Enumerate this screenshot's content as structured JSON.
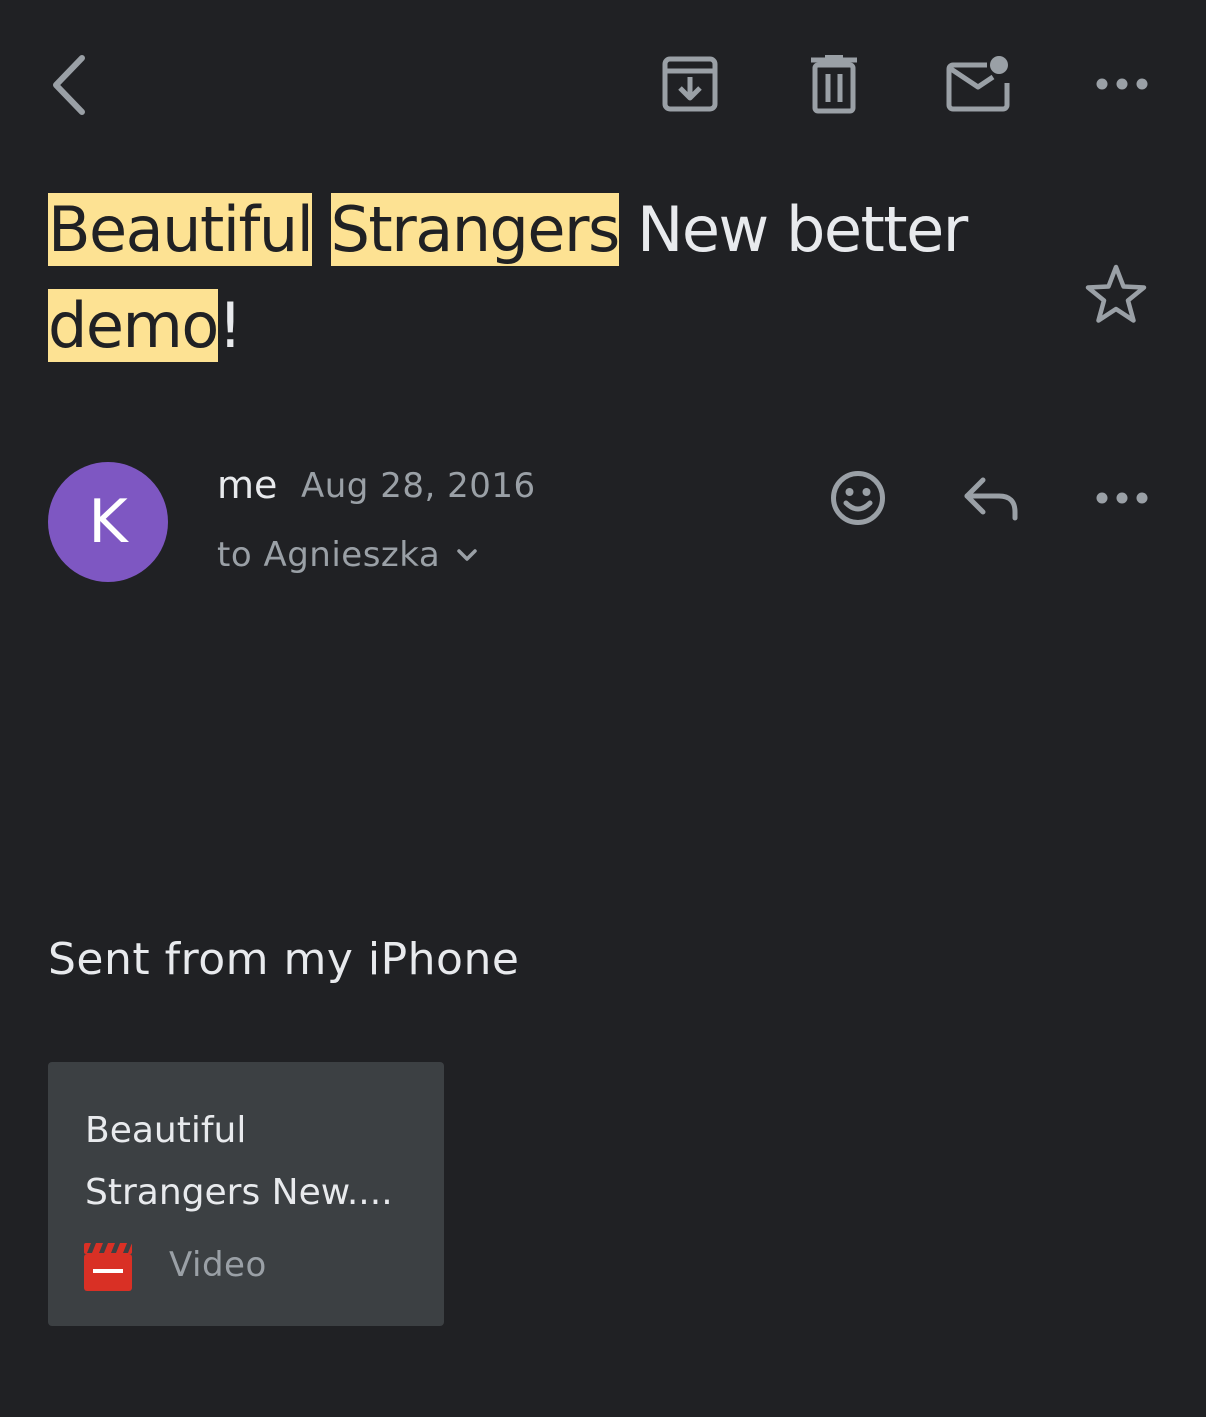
{
  "toolbar": {
    "back_icon": "back-arrow-icon",
    "archive_icon": "archive-icon",
    "delete_icon": "trash-icon",
    "mark_unread_icon": "mark-unread-icon",
    "more_icon": "more-horizontal-icon"
  },
  "subject": {
    "words": [
      {
        "text": "Beautiful",
        "highlighted": true
      },
      {
        "text": " "
      },
      {
        "text": "Strangers",
        "highlighted": true
      },
      {
        "text": " New better "
      },
      {
        "text": "demo",
        "highlighted": true
      },
      {
        "text": "!"
      }
    ],
    "star_icon": "star-outline-icon"
  },
  "message": {
    "avatar_letter": "K",
    "avatar_color": "#7e57c2",
    "sender": "me",
    "date": "Aug 28, 2016",
    "recipient": "to Agnieszka",
    "body": "Sent from my iPhone",
    "actions": {
      "emoji_icon": "emoji-reaction-icon",
      "reply_icon": "reply-icon",
      "more_icon": "more-horizontal-icon"
    }
  },
  "attachment": {
    "title": "Beautiful Strangers New....",
    "title_line1": "Beautiful",
    "title_line2": "Strangers New....",
    "type": "Video",
    "icon": "video-clapper-icon",
    "icon_color": "#d93025"
  },
  "colors": {
    "background": "#202124",
    "highlight": "#fde293",
    "icon_gray": "#9aa0a6",
    "card": "#3c4043"
  }
}
